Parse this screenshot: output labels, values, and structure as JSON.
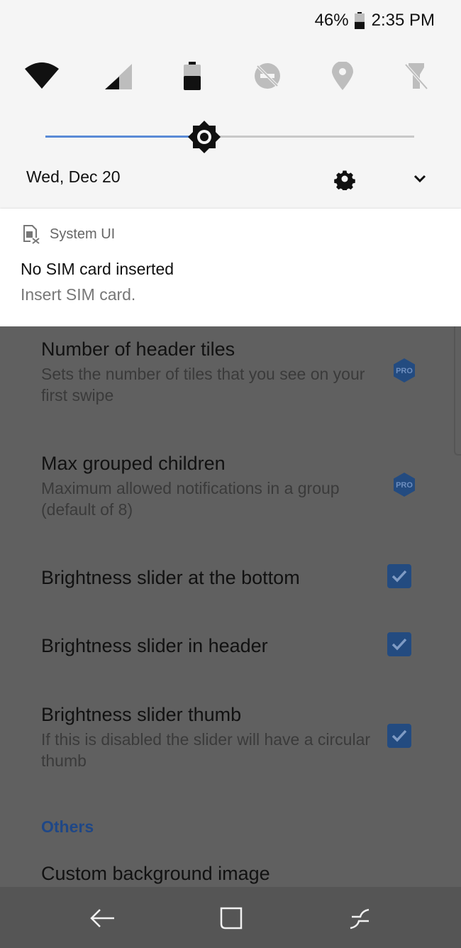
{
  "status_bar": {
    "battery_percent": "46%",
    "time": "2:35 PM",
    "battery_level": 0.46
  },
  "quick_tiles": [
    {
      "name": "wifi-icon"
    },
    {
      "name": "cellular-signal-icon"
    },
    {
      "name": "battery-saver-icon"
    },
    {
      "name": "do-not-disturb-off-icon"
    },
    {
      "name": "location-icon"
    },
    {
      "name": "flashlight-off-icon"
    }
  ],
  "brightness": {
    "level": 0.43
  },
  "header": {
    "date": "Wed, Dec 20"
  },
  "notification": {
    "app_name": "System UI",
    "title": "No SIM card inserted",
    "body": "Insert SIM card."
  },
  "settings": {
    "items": [
      {
        "title": "Number of header tiles",
        "subtitle": "Sets the number of tiles that you see on your first swipe",
        "badge": "PRO"
      },
      {
        "title": "Max grouped children",
        "subtitle": "Maximum allowed notifications in a group (default of 8)",
        "badge": "PRO"
      },
      {
        "title": "Brightness slider at the bottom",
        "checked": true
      },
      {
        "title": "Brightness slider in header",
        "checked": true
      },
      {
        "title": "Brightness slider thumb",
        "subtitle": "If this is disabled the slider will have a circular thumb",
        "checked": true
      }
    ],
    "section_others": "Others",
    "next_item_title": "Custom background image"
  },
  "colors": {
    "accent": "#5a8bd6",
    "checkbox": "#234b80",
    "section": "#1f4786",
    "scrim": "#606060"
  }
}
